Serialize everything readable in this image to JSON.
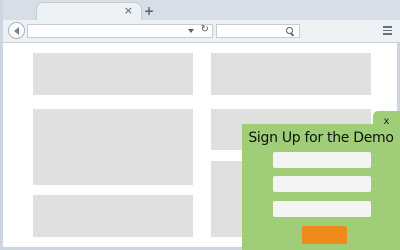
{
  "tab": {
    "close_glyph": "×"
  },
  "new_tab": {
    "glyph": "+"
  },
  "toolbar": {
    "url": {
      "reload_glyph": "↻"
    },
    "search": {
      "placeholder": ""
    }
  },
  "popup": {
    "close_label": "x",
    "title": "Sign Up for the Demo",
    "fields": [
      "",
      "",
      ""
    ],
    "submit_label": ""
  },
  "colors": {
    "popup_background": "#9fcd78",
    "submit_button": "#f08a1d",
    "placeholder_block": "#e0e0e0",
    "browser_chrome": "#d8dee6"
  },
  "icons": [
    "back-icon",
    "dropdown-icon",
    "reload-icon",
    "search-icon",
    "menu-icon",
    "close-icon",
    "plus-icon"
  ]
}
